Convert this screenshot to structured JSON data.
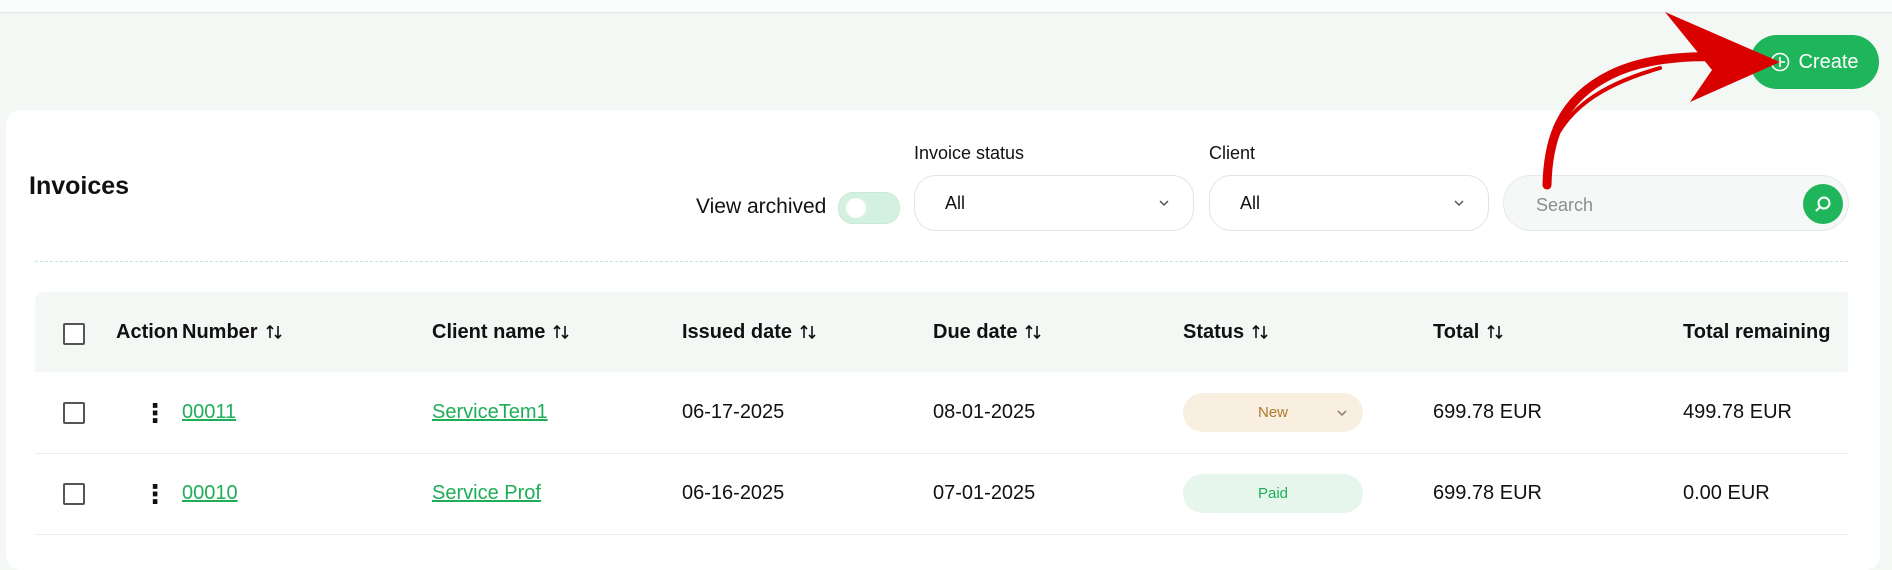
{
  "header": {
    "create_label": "Create"
  },
  "toolbar": {
    "title": "Invoices",
    "view_archived_label": "View archived",
    "view_archived_on": false,
    "invoice_status": {
      "label": "Invoice status",
      "value": "All"
    },
    "client": {
      "label": "Client",
      "value": "All"
    },
    "search": {
      "placeholder": "Search"
    }
  },
  "table": {
    "columns": {
      "action": "Action",
      "number": "Number",
      "client_name": "Client name",
      "issued_date": "Issued date",
      "due_date": "Due date",
      "status": "Status",
      "total": "Total",
      "total_remaining": "Total remaining"
    },
    "rows": [
      {
        "number": "00011",
        "client_name": "ServiceTem1",
        "issued_date": "06-17-2025",
        "due_date": "08-01-2025",
        "status": "New",
        "total": "699.78 EUR",
        "total_remaining": "499.78 EUR"
      },
      {
        "number": "00010",
        "client_name": "Service Prof",
        "issued_date": "06-16-2025",
        "due_date": "07-01-2025",
        "status": "Paid",
        "total": "699.78 EUR",
        "total_remaining": "0.00 EUR"
      }
    ]
  },
  "colors": {
    "accent": "#1fb55a",
    "status_new_bg": "#f8efe1",
    "status_new_text": "#b07a2a",
    "status_paid_bg": "#e6f6ec",
    "status_paid_text": "#1fae58",
    "annotation_arrow": "#d90000"
  }
}
